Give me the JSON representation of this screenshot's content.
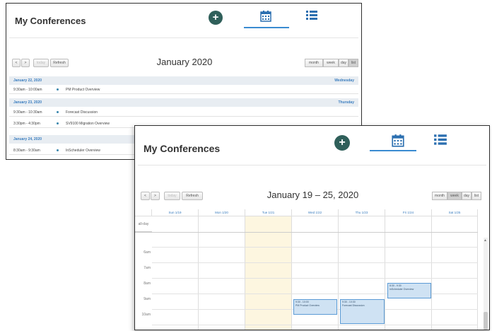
{
  "back_window": {
    "app_title": "My Conferences",
    "toolbar": {
      "prev": "<",
      "next": ">",
      "today": "today",
      "refresh": "Refresh"
    },
    "period_title": "January 2020",
    "views": [
      "month",
      "week",
      "day",
      "list"
    ],
    "active_view": "list",
    "days": [
      {
        "date": "January 22, 2020",
        "weekday": "Wednesday",
        "events": [
          {
            "time": "9:30am - 10:00am",
            "title": "PM Product Overview"
          }
        ]
      },
      {
        "date": "January 23, 2020",
        "weekday": "Thursday",
        "events": [
          {
            "time": "9:30am - 10:30am",
            "title": "Forecast Discussion"
          },
          {
            "time": "3:30pm - 4:30pm",
            "title": "SV9100 Migration Overview"
          }
        ]
      },
      {
        "date": "January 24, 2020",
        "weekday": "",
        "events": [
          {
            "time": "8:30am - 9:30am",
            "title": "InScheduler Overview"
          }
        ]
      }
    ]
  },
  "front_window": {
    "app_title": "My Conferences",
    "toolbar": {
      "prev": "<",
      "next": ">",
      "today": "today",
      "refresh": "Refresh"
    },
    "period_title": "January 19 – 25, 2020",
    "views": [
      "month",
      "week",
      "day",
      "list"
    ],
    "active_view": "week",
    "columns": [
      "Sun 1/19",
      "Mon 1/20",
      "Tue 1/21",
      "Wed 1/22",
      "Thu 1/23",
      "Fri 1/24",
      "Sat 1/25"
    ],
    "today_column": "Tue 1/21",
    "allday_label": "all-day",
    "hours": [
      "6am",
      "7am",
      "8am",
      "9am",
      "10am"
    ],
    "events": [
      {
        "time": "8:30 - 9:30",
        "title": "InScheduler Overview",
        "day": "Fri 1/24"
      },
      {
        "time": "9:30 - 10:00",
        "title": "PM Product Overview",
        "day": "Wed 1/22"
      },
      {
        "time": "9:30 - 10:30",
        "title": "Forecast Discussion",
        "day": "Thu 1/23"
      }
    ]
  },
  "colors": {
    "accent": "#3a8bd1",
    "add_button": "#2f5f5a",
    "event_fill": "#cfe2f3",
    "today_fill": "#fdf6e0"
  },
  "icons": {
    "add": "plus-circle-icon",
    "calendar": "calendar-icon",
    "list": "list-icon"
  }
}
